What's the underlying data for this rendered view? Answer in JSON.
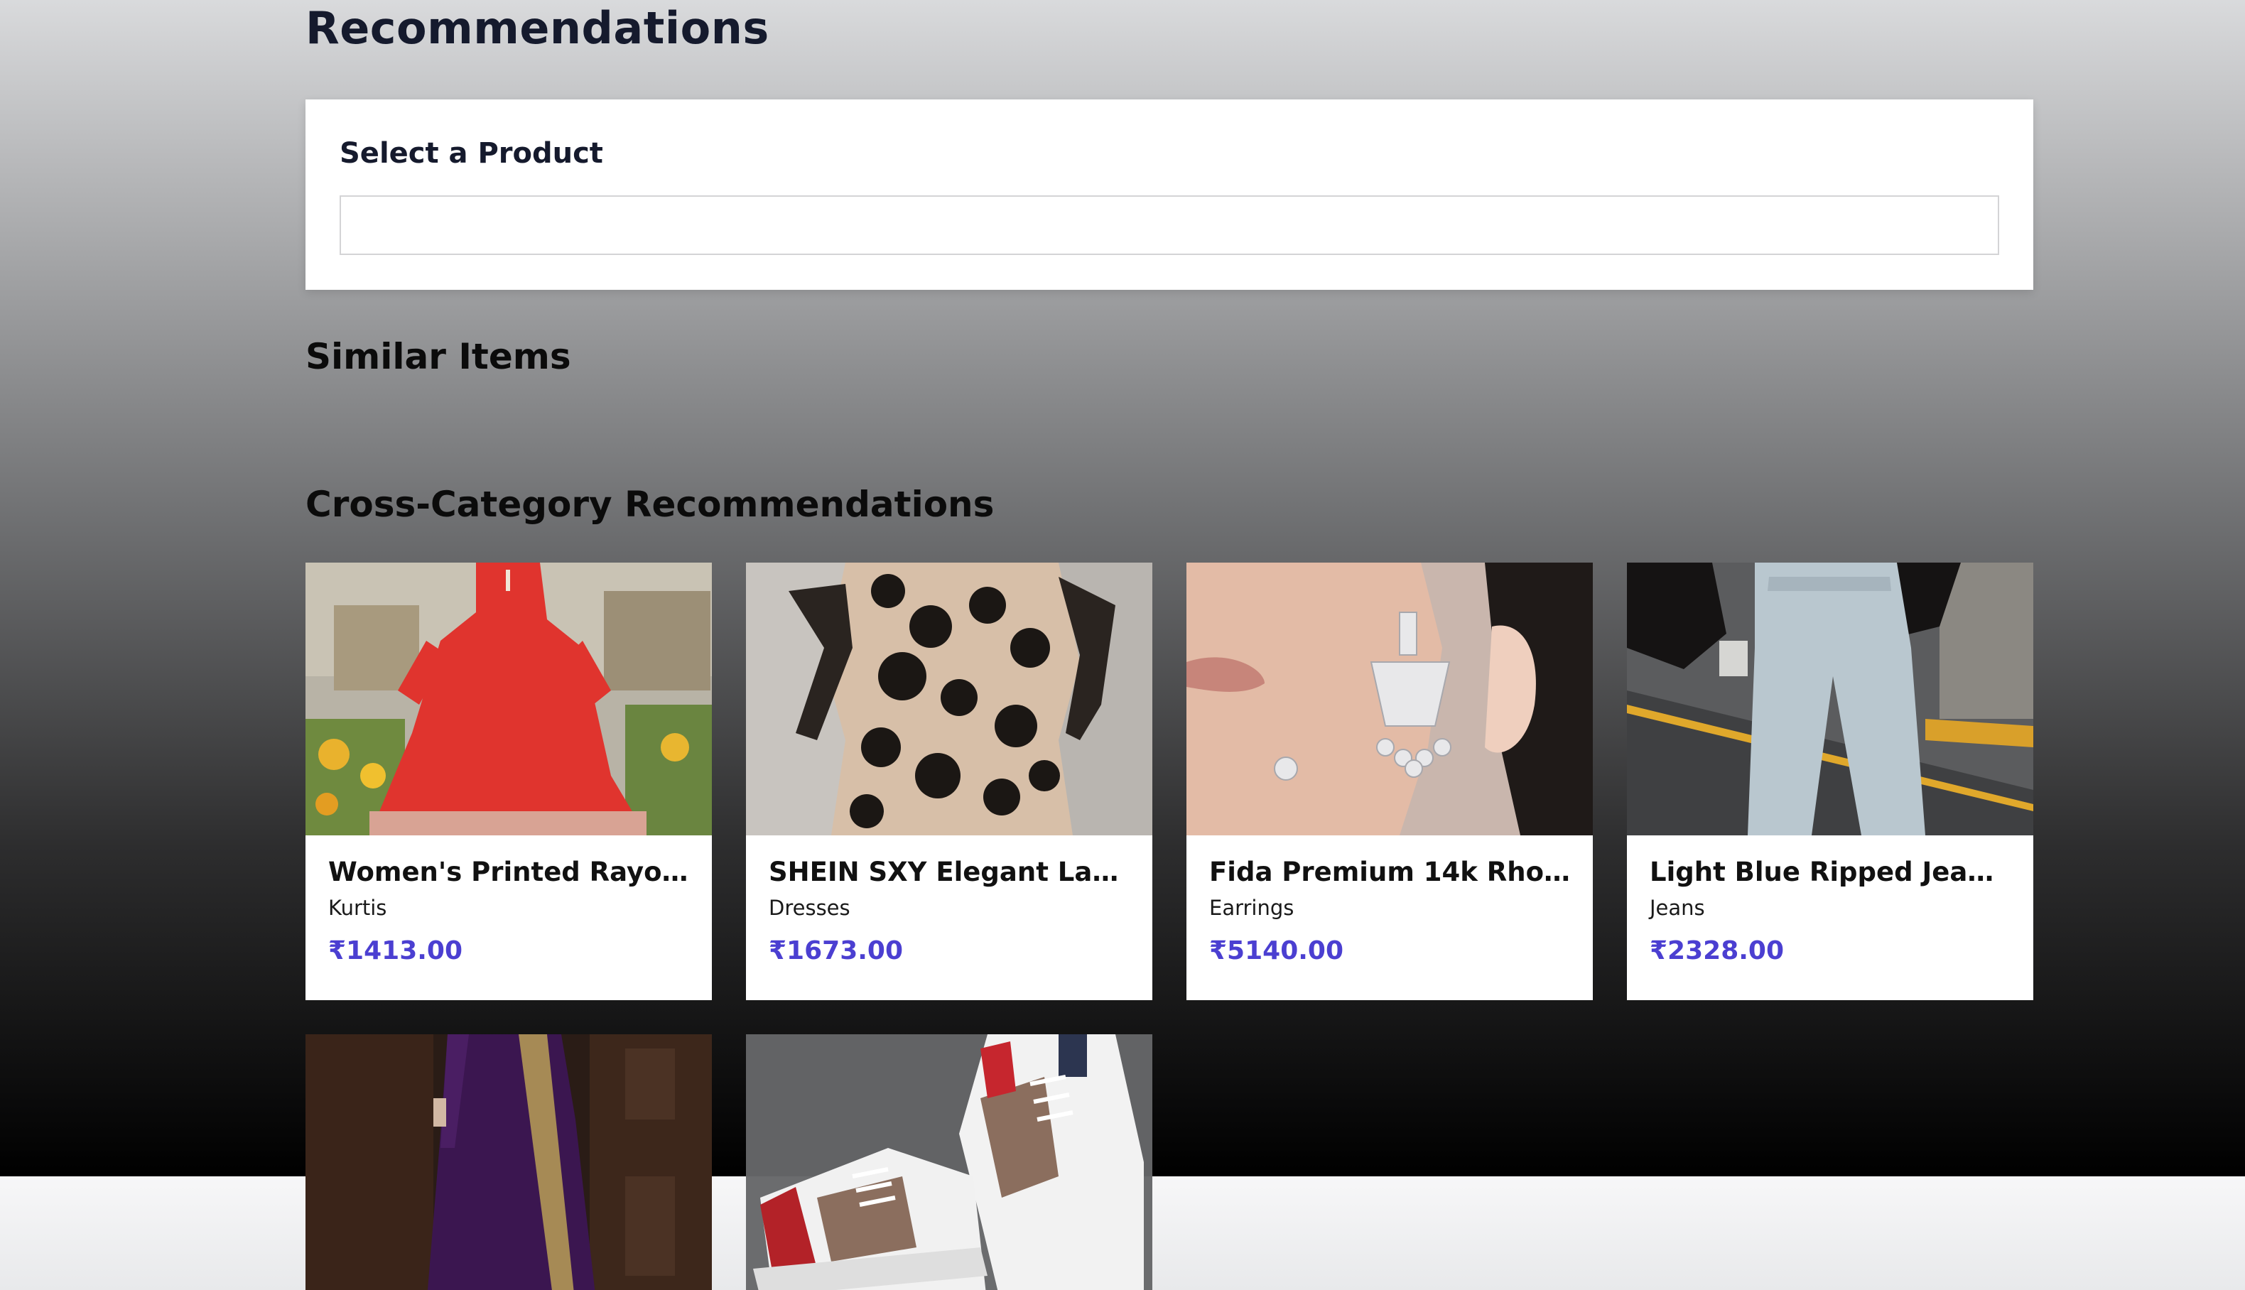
{
  "page": {
    "title": "Recommendations"
  },
  "selector": {
    "label": "Select a Product",
    "value": "",
    "placeholder": ""
  },
  "sections": {
    "similar_title": "Similar Items",
    "cross_title": "Cross-Category Recommendations"
  },
  "colors": {
    "price": "#4b3fd1",
    "heading": "#151a2d"
  },
  "products": [
    {
      "name": "Women's Printed Rayon Lo...",
      "category": "Kurtis",
      "price": "₹1413.00",
      "image": "red-anarkali-kurti-photo"
    },
    {
      "name": "SHEIN SXY Elegant Lace Pri...",
      "category": "Dresses",
      "price": "₹1673.00",
      "image": "black-lace-dress-photo"
    },
    {
      "name": "Fida Premium 14k Rhodiu...",
      "category": "Earrings",
      "price": "₹5140.00",
      "image": "silver-earring-photo"
    },
    {
      "name": "Light Blue Ripped Jeans Fe...",
      "category": "Jeans",
      "price": "₹2328.00",
      "image": "light-blue-jeans-photo"
    },
    {
      "name": "",
      "category": "",
      "price": "",
      "image": "purple-saree-photo"
    },
    {
      "name": "",
      "category": "",
      "price": "",
      "image": "white-sneakers-photo"
    }
  ]
}
